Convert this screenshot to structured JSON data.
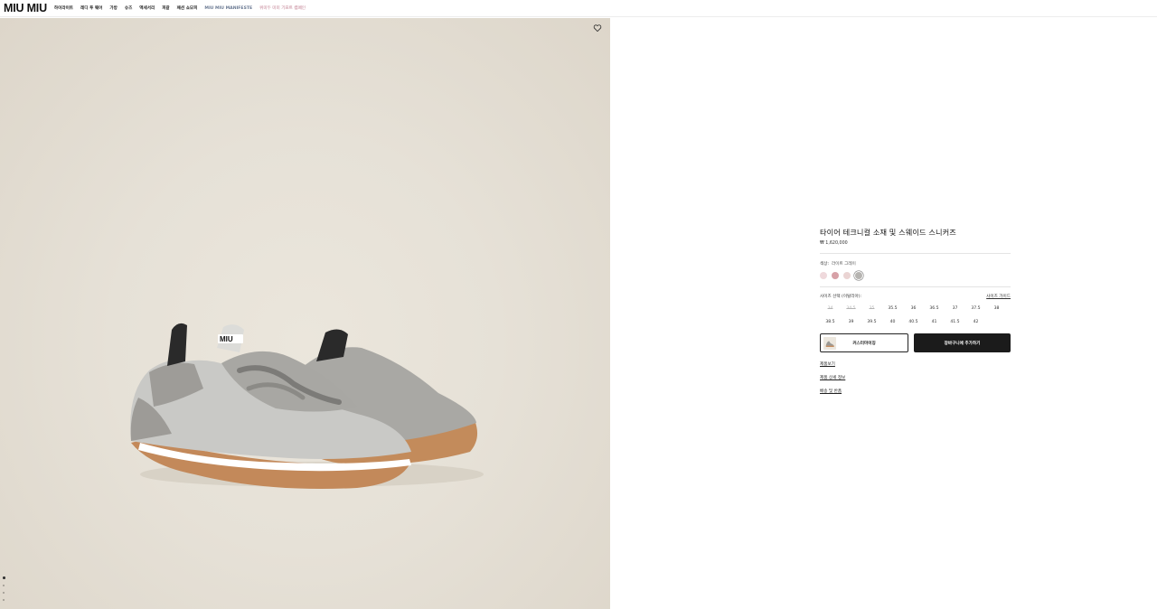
{
  "header": {
    "logo": "MIU MIU",
    "nav": [
      {
        "id": "highlights",
        "label": "하이라이트"
      },
      {
        "id": "ready-to-wear",
        "label": "레디 투 웨어"
      },
      {
        "id": "bags",
        "label": "가방"
      },
      {
        "id": "shoes",
        "label": "슈즈"
      },
      {
        "id": "accessories",
        "label": "액세서리"
      },
      {
        "id": "fragrance",
        "label": "피갈"
      },
      {
        "id": "fashion-show",
        "label": "패션 쇼모피"
      },
      {
        "id": "manifesto",
        "label": "MIU MIU MANIFESTE"
      },
      {
        "id": "campaign",
        "label": "위미두 미미 기프트 캠페인"
      }
    ]
  },
  "gallery": {
    "wishlist_icon": "heart-outline-icon",
    "dots": 4,
    "active_dot": 0
  },
  "product": {
    "title": "타이어 테크니컬 소재 및 스웨이드 스니커즈",
    "price": "₩ 1,620,000",
    "color_label": "색상:",
    "color_value": "라이트 그레이",
    "swatches": [
      {
        "name": "pale pink",
        "hex": "#efd9dc",
        "selected": false
      },
      {
        "name": "dusty rose",
        "hex": "#d7a1a7",
        "selected": false
      },
      {
        "name": "blush",
        "hex": "#ead4d3",
        "selected": false
      },
      {
        "name": "light gray",
        "hex": "#b6b4b1",
        "selected": true
      }
    ],
    "size_label": "사이즈 선택 (이탈리아):",
    "size_guide": "사이즈 가이드",
    "sizes": [
      {
        "label": "34",
        "available": false
      },
      {
        "label": "34.5",
        "available": false
      },
      {
        "label": "35",
        "available": false
      },
      {
        "label": "35.5",
        "available": true
      },
      {
        "label": "36",
        "available": true
      },
      {
        "label": "36.5",
        "available": true
      },
      {
        "label": "37",
        "available": true
      },
      {
        "label": "37.5",
        "available": true
      },
      {
        "label": "38",
        "available": true
      },
      {
        "label": "38.5",
        "available": true
      },
      {
        "label": "39",
        "available": true
      },
      {
        "label": "39.5",
        "available": true
      },
      {
        "label": "40",
        "available": true
      },
      {
        "label": "40.5",
        "available": true
      },
      {
        "label": "41",
        "available": true
      },
      {
        "label": "41.5",
        "available": true
      },
      {
        "label": "42",
        "available": true
      }
    ],
    "customize_label": "커스터마이징",
    "add_to_cart_label": "장바구니에 추가하기",
    "links": [
      {
        "id": "details",
        "label": "제품보기"
      },
      {
        "id": "product-info",
        "label": "제품 상세 정보"
      },
      {
        "id": "shipping",
        "label": "배송 및 반품"
      }
    ],
    "colors": {
      "accent_dark": "#1b1b1b",
      "background_image": "#e6e1d7"
    }
  }
}
